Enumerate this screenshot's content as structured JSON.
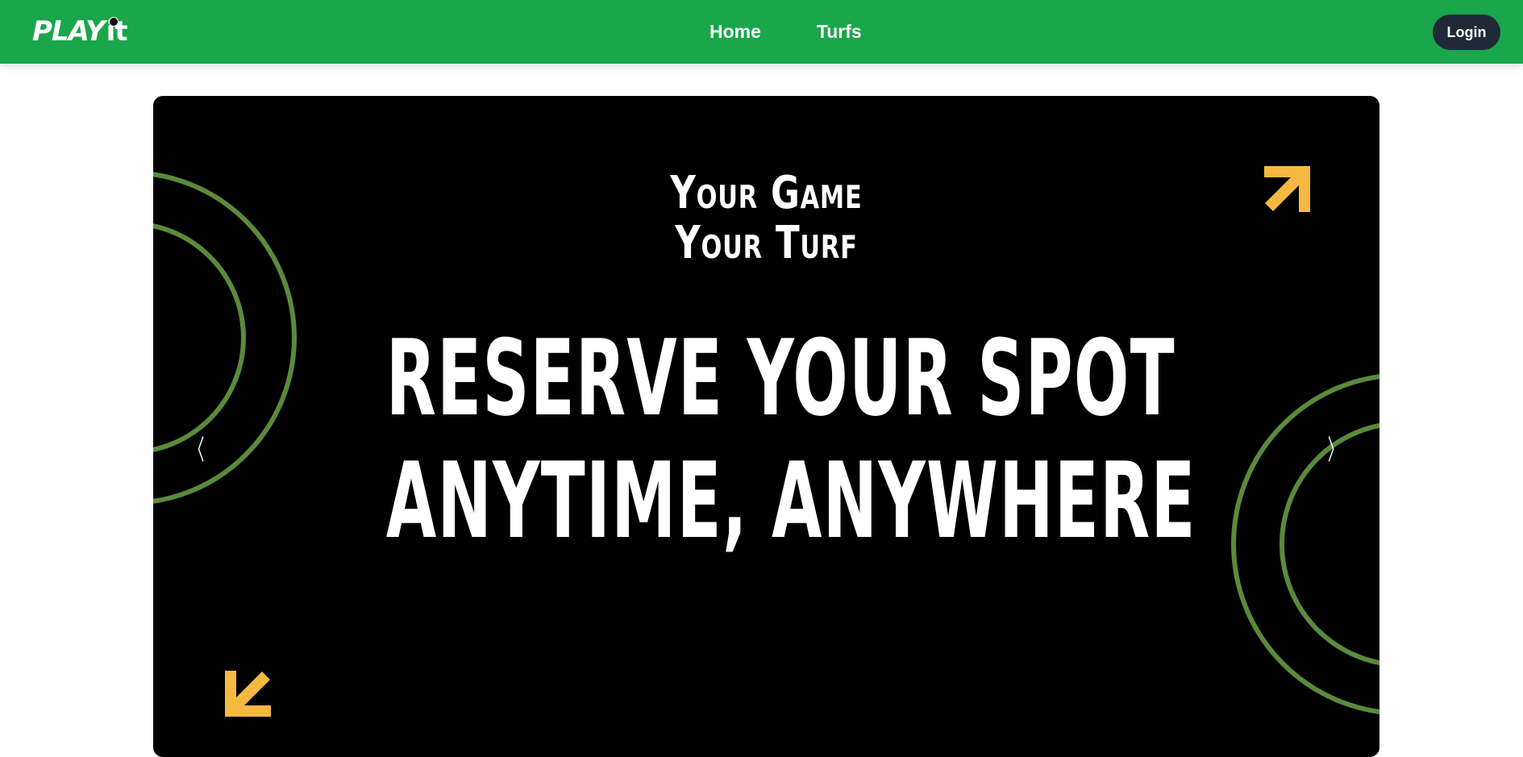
{
  "brand": {
    "logo_main": "PLAY",
    "logo_sub": "it"
  },
  "nav": {
    "links": [
      "Home",
      "Turfs"
    ],
    "login_label": "Login"
  },
  "hero": {
    "tagline_line1": "Your Game",
    "tagline_line2": "Your Turf",
    "headline_line1": "RESERVE YOUR SPOT",
    "headline_line2": "ANYTIME, ANYWHERE",
    "prev_glyph": "〈",
    "next_glyph": "〉"
  },
  "colors": {
    "navbar": "#1aa64b",
    "login_button": "#1f2937",
    "hero_background": "#000000",
    "ring_green": "#5b8a3c",
    "accent_arrow": "#f5b942"
  },
  "icons": {
    "top_right": "arrow-up-right-icon",
    "bottom_left": "arrow-down-left-icon"
  }
}
